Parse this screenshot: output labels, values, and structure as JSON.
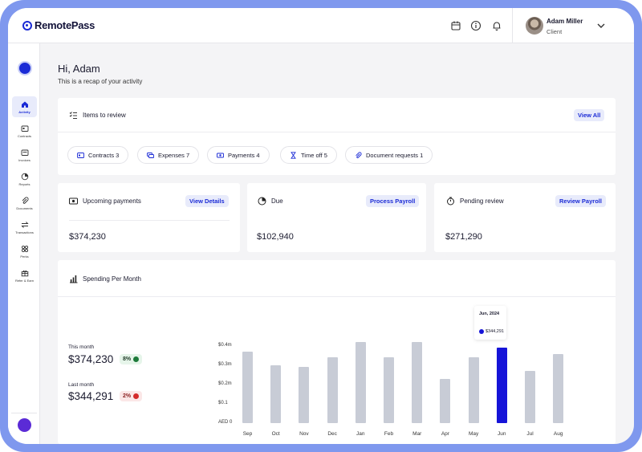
{
  "app": {
    "brand": "RemotePass"
  },
  "header": {
    "user_name": "Adam Miller",
    "user_role": "Client",
    "icons": [
      "calendar-icon",
      "info-icon",
      "bell-icon",
      "chevron-down-icon"
    ]
  },
  "sidebar": {
    "items": [
      {
        "label": "Activity",
        "icon": "home-icon",
        "active": true
      },
      {
        "label": "Contracts",
        "icon": "contract-icon"
      },
      {
        "label": "Invoices",
        "icon": "invoice-icon"
      },
      {
        "label": "Reports",
        "icon": "report-icon"
      },
      {
        "label": "Documents",
        "icon": "paperclip-icon"
      },
      {
        "label": "Transactions",
        "icon": "transfer-icon"
      },
      {
        "label": "Perks",
        "icon": "perks-icon"
      },
      {
        "label": "Refer & Earn",
        "icon": "gift-icon"
      }
    ]
  },
  "greeting": {
    "title": "Hi, Adam",
    "subtitle": "This is a recap of your activity"
  },
  "review": {
    "title": "Items to review",
    "view_all": "View All",
    "chips": [
      {
        "label": "Contracts 3",
        "icon": "contract-icon"
      },
      {
        "label": "Expenses 7",
        "icon": "expenses-icon"
      },
      {
        "label": "Payments 4",
        "icon": "payment-icon"
      },
      {
        "label": "Time off 5",
        "icon": "hourglass-icon"
      },
      {
        "label": "Document requests 1",
        "icon": "paperclip-icon"
      }
    ]
  },
  "summary_cards": [
    {
      "title": "Upcoming payments",
      "action": "View Details",
      "amount": "$374,230",
      "icon": "cash-icon"
    },
    {
      "title": "Due",
      "action": "Process Payroll",
      "amount": "$102,940",
      "icon": "clock-icon"
    },
    {
      "title": "Pending review",
      "action": "Review Payroll",
      "amount": "$271,290",
      "icon": "stopwatch-icon"
    }
  ],
  "spending": {
    "title": "Spending Per Month",
    "this_month_label": "This month",
    "this_month_value": "$374,230",
    "this_month_change": "8%",
    "last_month_label": "Last month",
    "last_month_value": "$344,291",
    "last_month_change": "2%"
  },
  "chart_data": {
    "type": "bar",
    "categories": [
      "Sep",
      "Oct",
      "Nov",
      "Dec",
      "Jan",
      "Feb",
      "Mar",
      "Apr",
      "May",
      "Jun",
      "Jul",
      "Aug"
    ],
    "values": [
      0.37,
      0.3,
      0.29,
      0.34,
      0.42,
      0.34,
      0.42,
      0.23,
      0.34,
      0.39,
      0.27,
      0.36
    ],
    "highlight_index": 9,
    "y_ticks": [
      "AED 0",
      "$0.1",
      "$0.2m",
      "$0.3m",
      "$0.4m"
    ],
    "ylim": [
      0,
      0.4
    ],
    "y_unit": "m",
    "colors": {
      "bar": "#c8ccd6",
      "highlight": "#1614d8"
    },
    "tooltip": {
      "title": "Jun, 2024",
      "value": "$344,291"
    }
  }
}
